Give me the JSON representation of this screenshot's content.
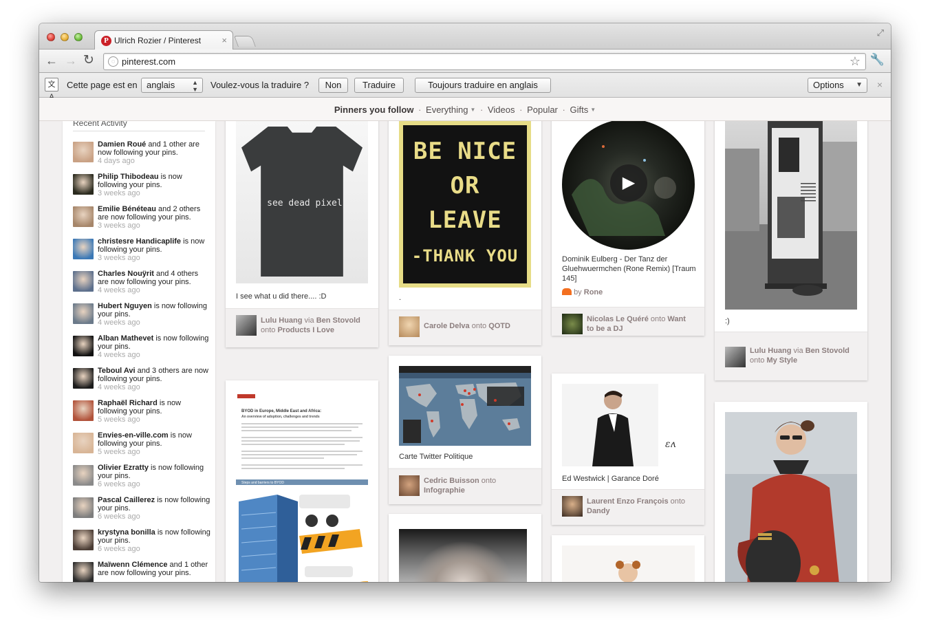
{
  "browser": {
    "tab_title": "Ulrich Rozier / Pinterest",
    "tab_close": "×",
    "url": "pinterest.com"
  },
  "translate_bar": {
    "prefix": "Cette page est en",
    "language": "anglais",
    "question": "Voulez-vous la traduire ?",
    "no_label": "Non",
    "translate_label": "Traduire",
    "always_label": "Toujours traduire en anglais",
    "options_label": "Options",
    "close": "×"
  },
  "pin_nav": {
    "items": [
      "Pinners you follow",
      "Everything",
      "Videos",
      "Popular",
      "Gifts"
    ],
    "separator": "·"
  },
  "sidebar": {
    "title": "Recent Activity",
    "activities": [
      {
        "name": "Damien Roué",
        "action": " and 1 other are now following your pins.",
        "time": "4 days ago",
        "color": "#c9a184"
      },
      {
        "name": "Philip Thibodeau",
        "action": " is now following your pins.",
        "time": "3 weeks ago",
        "color": "#2a2a1e"
      },
      {
        "name": "Emilie Bénéteau",
        "action": " and 2 others are now following your pins.",
        "time": "3 weeks ago",
        "color": "#a6866a"
      },
      {
        "name": "christesre Handicaplife",
        "action": " is now following your pins.",
        "time": "3 weeks ago",
        "color": "#3a78b6"
      },
      {
        "name": "Charles Nouÿrit",
        "action": " and 4 others are now following your pins.",
        "time": "4 weeks ago",
        "color": "#5c6f8c"
      },
      {
        "name": "Hubert Nguyen",
        "action": " is now following your pins.",
        "time": "4 weeks ago",
        "color": "#6b7a8a"
      },
      {
        "name": "Alban Mathevet",
        "action": " is now following your pins.",
        "time": "4 weeks ago",
        "color": "#111111"
      },
      {
        "name": "Teboul Avi",
        "action": " and 3 others are now following your pins.",
        "time": "4 weeks ago",
        "color": "#1c1c1c"
      },
      {
        "name": "Raphaël Richard",
        "action": " is now following your pins.",
        "time": "5 weeks ago",
        "color": "#b1523a"
      },
      {
        "name": "Envies-en-ville.com",
        "action": " is now following your pins.",
        "time": "5 weeks ago",
        "color": "#d8b596"
      },
      {
        "name": "Olivier Ezratty",
        "action": " is now following your pins.",
        "time": "6 weeks ago",
        "color": "#8a8a8a"
      },
      {
        "name": "Pascal Caillerez",
        "action": " is now following your pins.",
        "time": "6 weeks ago",
        "color": "#7d7d7d"
      },
      {
        "name": "krystyna bonilla",
        "action": " is now following your pins.",
        "time": "6 weeks ago",
        "color": "#4b3d35"
      },
      {
        "name": "Maïwenn Clémence",
        "action": " and 1 other are now following your pins.",
        "time": "",
        "color": "#2c2c2c"
      }
    ]
  },
  "pins": [
    {
      "desc": "I see what u did there.... :D",
      "shirt_text": "I see dead pixels",
      "user": "Lulu Huang",
      "via_word": " via ",
      "via": "Ben Stovold",
      "onto_word": "onto ",
      "board": "Products I Love"
    },
    {
      "desc": ".",
      "poster_lines": [
        "BE NICE",
        "OR",
        "LEAVE",
        "-THANK YOU"
      ],
      "user": "Carole Delva",
      "onto_word": " onto ",
      "board": "QOTD"
    },
    {
      "desc": "Dominik Eulberg - Der Tanz der Gluehwuermchen (Rone Remix) [Traum 145]",
      "source_prefix": "by ",
      "source": "Rone",
      "user": "Nicolas Le Quéré",
      "onto_word": " onto ",
      "board": "Want to be a DJ"
    },
    {
      "desc": ":)",
      "user": "Lulu Huang",
      "via_word": " via ",
      "via": "Ben Stovold",
      "onto_word": "onto ",
      "board": "My Style"
    },
    {
      "desc": "Carte Twitter Politique",
      "user": "Cedric Buisson",
      "onto_word": " onto ",
      "board": "Infographie"
    },
    {
      "desc": "Ed Westwick | Garance Doré",
      "user": "Laurent Enzo François",
      "onto_word": " onto ",
      "board": "Dandy"
    },
    {
      "infographic_heading": "BYOD in Europe, Middle East and Africa:",
      "infographic_sub": "An overview of adoption, challenges and trends",
      "infographic_section": "Steps and barriers to BYOD"
    }
  ],
  "colors": {
    "pinterest_red": "#cb2027",
    "attribution_text": "#8c7e7e",
    "page_bg": "#f2f0f0"
  }
}
